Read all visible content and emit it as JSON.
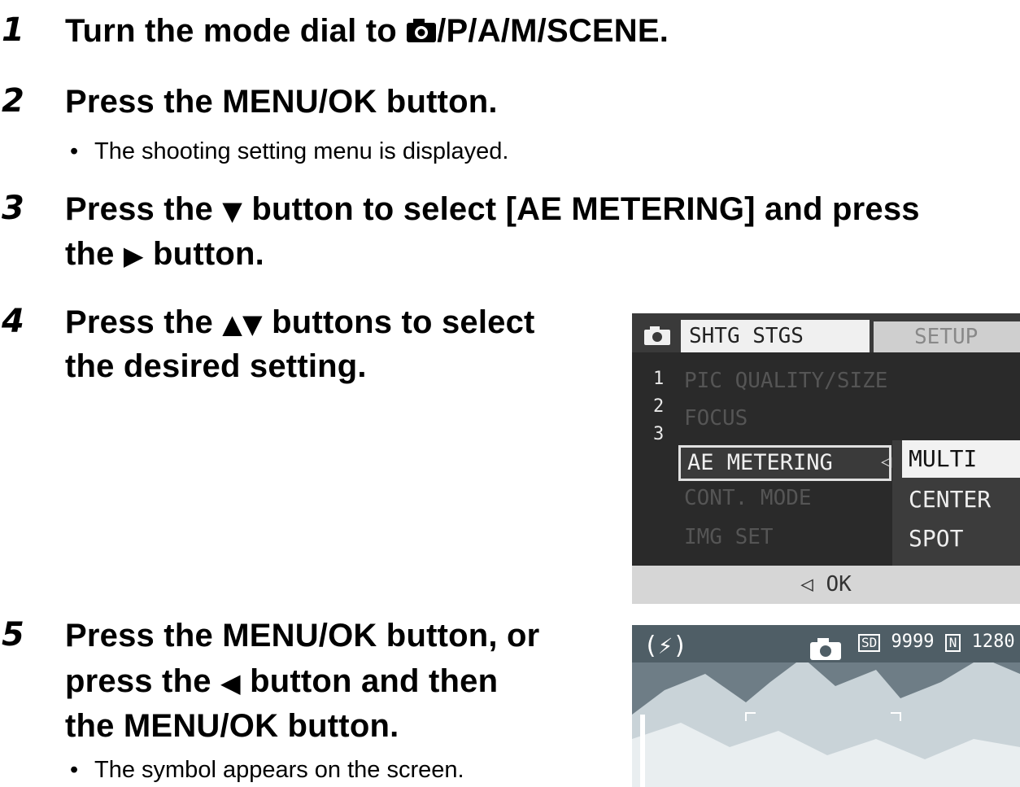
{
  "steps": [
    {
      "number": "1",
      "text_before": "Turn the mode dial to ",
      "text_after": "/P/A/M/SCENE."
    },
    {
      "number": "2",
      "text": "Press the MENU/OK button.",
      "bullet": "The shooting setting menu is displayed."
    },
    {
      "number": "3",
      "line1_a": "Press the ",
      "line1_b": " button to select [AE METERING] and press",
      "line2_a": "the ",
      "line2_b": " button."
    },
    {
      "number": "4",
      "line1_a": "Press the ",
      "line1_b": " buttons to select",
      "line2": "the desired setting."
    },
    {
      "number": "5",
      "line1": "Press the MENU/OK button, or",
      "line2_a": "press the ",
      "line2_b": " button and then",
      "line3": "the MENU/OK button.",
      "bullet": "The symbol appears on the screen."
    }
  ],
  "glyphs": {
    "down": "▼",
    "right": "▶",
    "updown": "▲▼",
    "left": "◀",
    "bullet": "•"
  },
  "camera_menu": {
    "tab_active": "SHTG STGS",
    "tab_inactive": "SETUP",
    "pages": [
      "1",
      "2",
      "3"
    ],
    "items": [
      "PIC QUALITY/SIZE",
      "FOCUS",
      "AE METERING",
      "CONT. MODE",
      "IMG SET"
    ],
    "selected_item": "AE METERING",
    "options": [
      "MULTI",
      "CENTER",
      "SPOT"
    ],
    "selected_option": "MULTI",
    "footer": "OK",
    "footer_icon": "◁"
  },
  "preview_screen": {
    "flash_icon": "(⚡)",
    "card": "SD",
    "remaining": "9999",
    "quality": "N",
    "size": "1280"
  }
}
